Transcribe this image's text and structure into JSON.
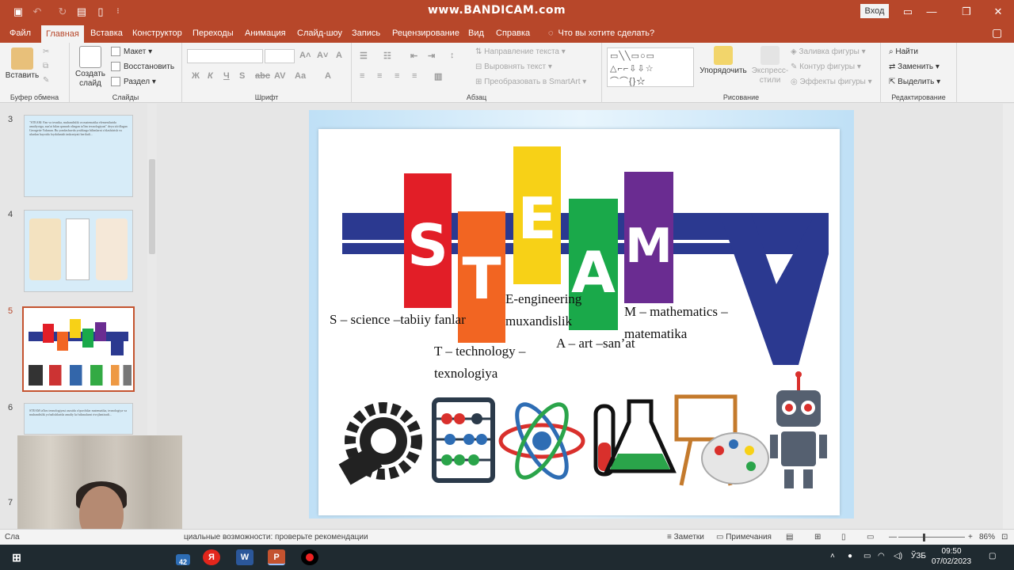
{
  "window": {
    "title": "www.BANDICAM.com",
    "signin_label": "Вход"
  },
  "tabs": [
    {
      "label": "Файл"
    },
    {
      "label": "Главная"
    },
    {
      "label": "Вставка"
    },
    {
      "label": "Конструктор"
    },
    {
      "label": "Переходы"
    },
    {
      "label": "Анимация"
    },
    {
      "label": "Слайд-шоу"
    },
    {
      "label": "Запись"
    },
    {
      "label": "Рецензирование"
    },
    {
      "label": "Вид"
    },
    {
      "label": "Справка"
    }
  ],
  "tell_me": "Что вы хотите сделать?",
  "ribbon": {
    "clipboard": {
      "paste": "Вставить",
      "group": "Буфер обмена"
    },
    "slides": {
      "new_slide": "Создать слайд",
      "layout": "Макет",
      "reset": "Восстановить",
      "section": "Раздел",
      "group": "Слайды"
    },
    "font": {
      "group": "Шрифт",
      "bold": "Ж",
      "italic": "К",
      "underline": "Ч",
      "strike": "S",
      "spacing": "AV",
      "case": "Aa"
    },
    "paragraph": {
      "text_direction": "Направление текста",
      "align_text": "Выровнять текст",
      "smartart": "Преобразовать в SmartArt",
      "group": "Абзац"
    },
    "drawing": {
      "arrange": "Упорядочить",
      "quick_styles": "Экспресс-стили",
      "fill": "Заливка фигуры",
      "outline": "Контур фигуры",
      "effects": "Эффекты фигуры",
      "group": "Рисование"
    },
    "editing": {
      "find": "Найти",
      "replace": "Заменить",
      "select": "Выделить",
      "group": "Редактирование"
    }
  },
  "thumbnails": [
    {
      "number": "3",
      "text": "\"STEAM: Fan va texnika, muhandislik va matematika elementlarida amaliyotga, sun'at bilan qamrab olingan ta'lim texnologiyasi\" deya ta'riflagan Georgette Yakman. Bu yondashuvda yoshlarga bilimlarni o'zlashtirish va ulardan hayotda foydalanish imkoniyati beriladi..."
    },
    {
      "number": "4",
      "text": ""
    },
    {
      "number": "5",
      "text": ""
    },
    {
      "number": "6",
      "text": "STEAM ta'lim texnologiyasi asosida o'quvchilar matematika, texnologiya va muhandislik yo'nalishlarida amaliy ko'nikmalarni rivojlantiradi..."
    },
    {
      "number": "7",
      "text": ""
    }
  ],
  "slide": {
    "letters": [
      "S",
      "T",
      "E",
      "A",
      "M"
    ],
    "captions": {
      "s": "S – science –tabiiy fanlar",
      "t1": "T – technology –",
      "t2": "texnologiya",
      "e1": "E-engineering",
      "e2": "muxandislik",
      "a": "A – art –san’at",
      "m1": "M – mathematics –",
      "m2": "matematika"
    },
    "colors": {
      "s": "#e21e27",
      "t": "#f26522",
      "e": "#f7d117",
      "a": "#1aa94a",
      "m": "#6a2c91",
      "band": "#2b3990"
    }
  },
  "status": {
    "slide_label": "Сла",
    "accessibility": "циальные возможности: проверьте рекомендации",
    "notes": "Заметки",
    "comments": "Примечания",
    "zoom": "86%"
  },
  "taskbar": {
    "badge": "42",
    "lang": "ЎЗБ",
    "time": "09:50",
    "date": "07/02/2023"
  }
}
